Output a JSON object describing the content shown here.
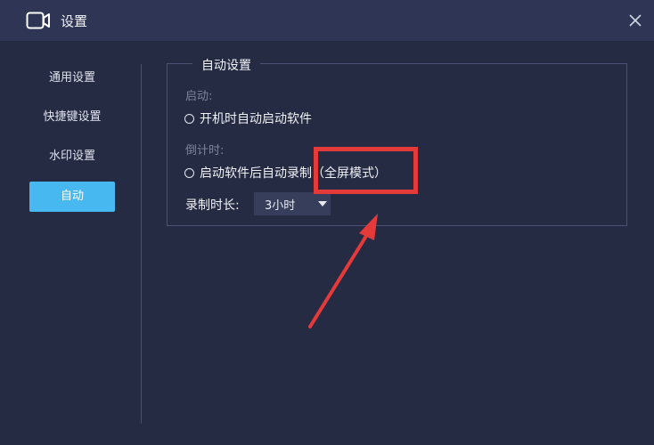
{
  "window": {
    "title": "设置",
    "icon": "video-camera-icon",
    "close_icon": "close-icon"
  },
  "sidebar": {
    "items": [
      {
        "label": "通用设置",
        "active": false
      },
      {
        "label": "快捷键设置",
        "active": false
      },
      {
        "label": "水印设置",
        "active": false
      },
      {
        "label": "自动",
        "active": true
      }
    ]
  },
  "auto_settings": {
    "legend": "自动设置",
    "startup_label": "启动:",
    "startup_option": "开机时自动启动软件",
    "countdown_label": "倒计时:",
    "countdown_option": "启动软件后自动录制（全屏模式）",
    "duration_label": "录制时长:",
    "duration_value": "3小时"
  },
  "annotation": {
    "color": "#e53a3a"
  },
  "colors": {
    "background": "#252b43",
    "titlebar": "#2f3655",
    "accent": "#48b8f0"
  }
}
